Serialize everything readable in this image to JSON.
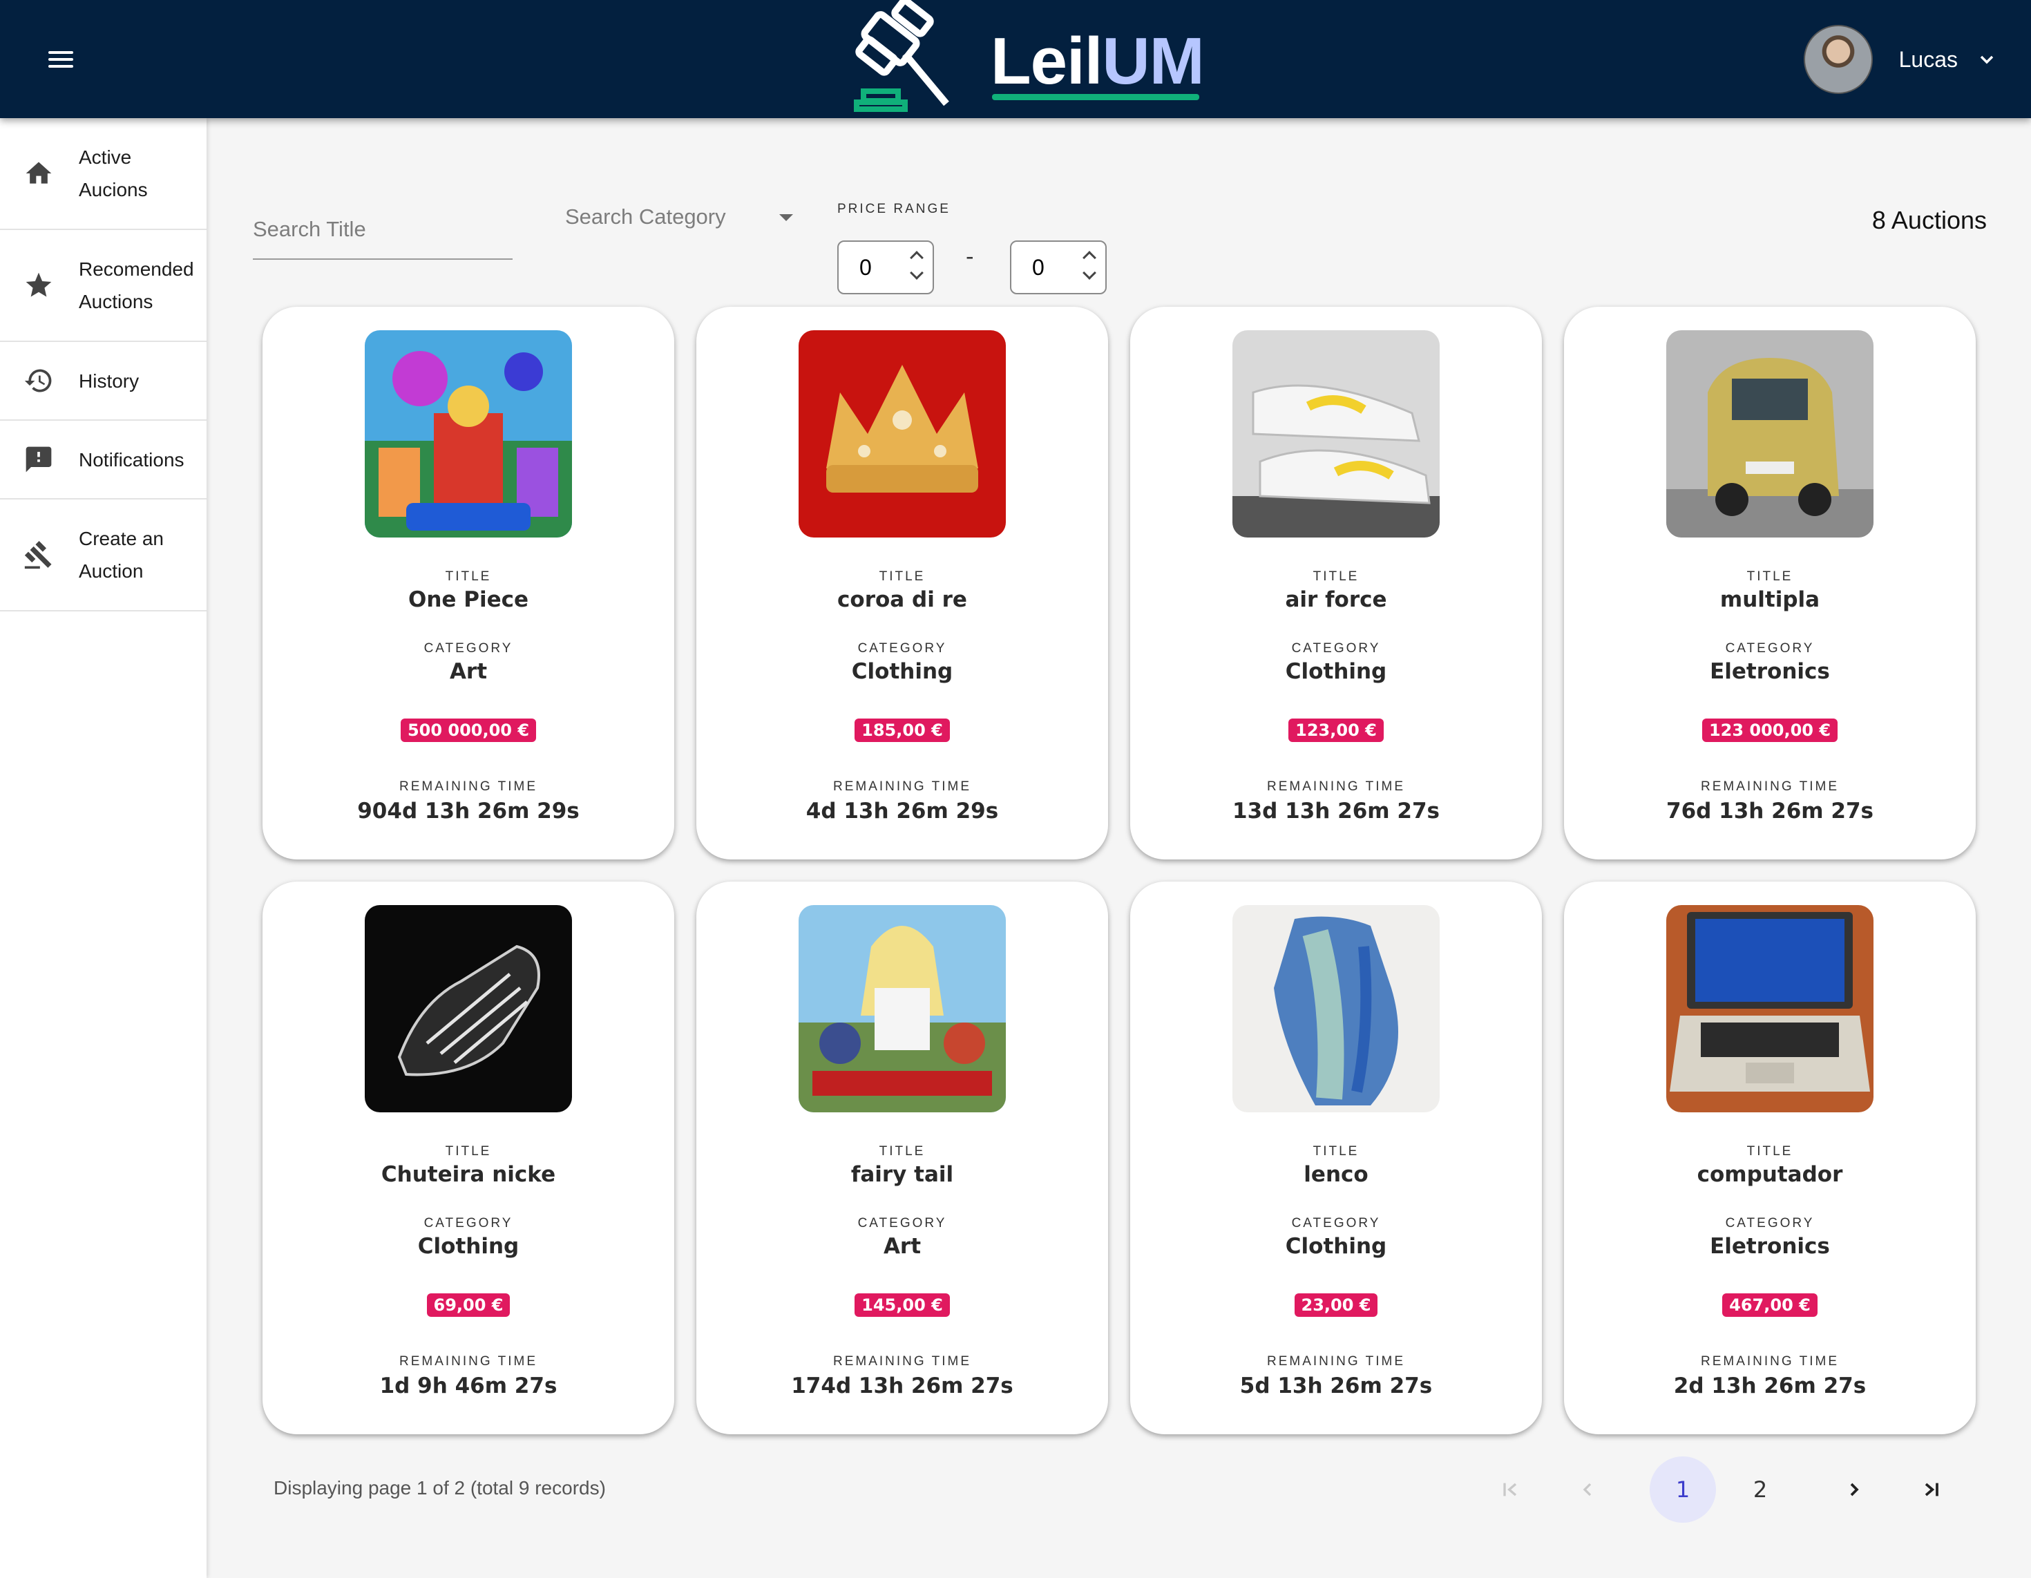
{
  "header": {
    "logo_a": "Leil",
    "logo_b": "UM",
    "user_name": "Lucas",
    "colors": {
      "bar": "#03203f",
      "accent": "#10b07a",
      "logo_um": "#b6c6ff"
    }
  },
  "sidebar": {
    "items": [
      {
        "icon": "home-icon",
        "label_1": "Active",
        "label_2": "Aucions"
      },
      {
        "icon": "star-icon",
        "label_1": "Recomended",
        "label_2": "Auctions"
      },
      {
        "icon": "history-icon",
        "label": "History"
      },
      {
        "icon": "notification-icon",
        "label": "Notifications"
      },
      {
        "icon": "gavel-icon",
        "label_1": "Create an",
        "label_2": "Auction"
      }
    ]
  },
  "filters": {
    "title_placeholder": "Search Title",
    "category_placeholder": "Search Category",
    "price_range_label": "PRICE RANGE",
    "price_min": "0",
    "price_max": "0",
    "separator": "-",
    "count_text": "8 Auctions"
  },
  "labels": {
    "title": "TITLE",
    "category": "CATEGORY",
    "remaining": "REMAINING TIME"
  },
  "cards": [
    {
      "title": "One Piece",
      "category": "Art",
      "price": "500 000,00 €",
      "remaining": "904d 13h 26m 29s"
    },
    {
      "title": "coroa di re",
      "category": "Clothing",
      "price": "185,00 €",
      "remaining": "4d 13h 26m 29s"
    },
    {
      "title": "air force",
      "category": "Clothing",
      "price": "123,00 €",
      "remaining": "13d 13h 26m 27s"
    },
    {
      "title": "multipla",
      "category": "Eletronics",
      "price": "123 000,00 €",
      "remaining": "76d 13h 26m 27s"
    },
    {
      "title": "Chuteira nicke",
      "category": "Clothing",
      "price": "69,00 €",
      "remaining": "1d 9h 46m 27s"
    },
    {
      "title": "fairy tail",
      "category": "Art",
      "price": "145,00 €",
      "remaining": "174d 13h 26m 27s"
    },
    {
      "title": "lenco",
      "category": "Clothing",
      "price": "23,00 €",
      "remaining": "5d 13h 26m 27s"
    },
    {
      "title": "computador",
      "category": "Eletronics",
      "price": "467,00 €",
      "remaining": "2d 13h 26m 27s"
    }
  ],
  "pagination": {
    "info": "Displaying page 1 of 2 (total 9 records)",
    "pages": [
      "1",
      "2"
    ],
    "current": "1"
  }
}
